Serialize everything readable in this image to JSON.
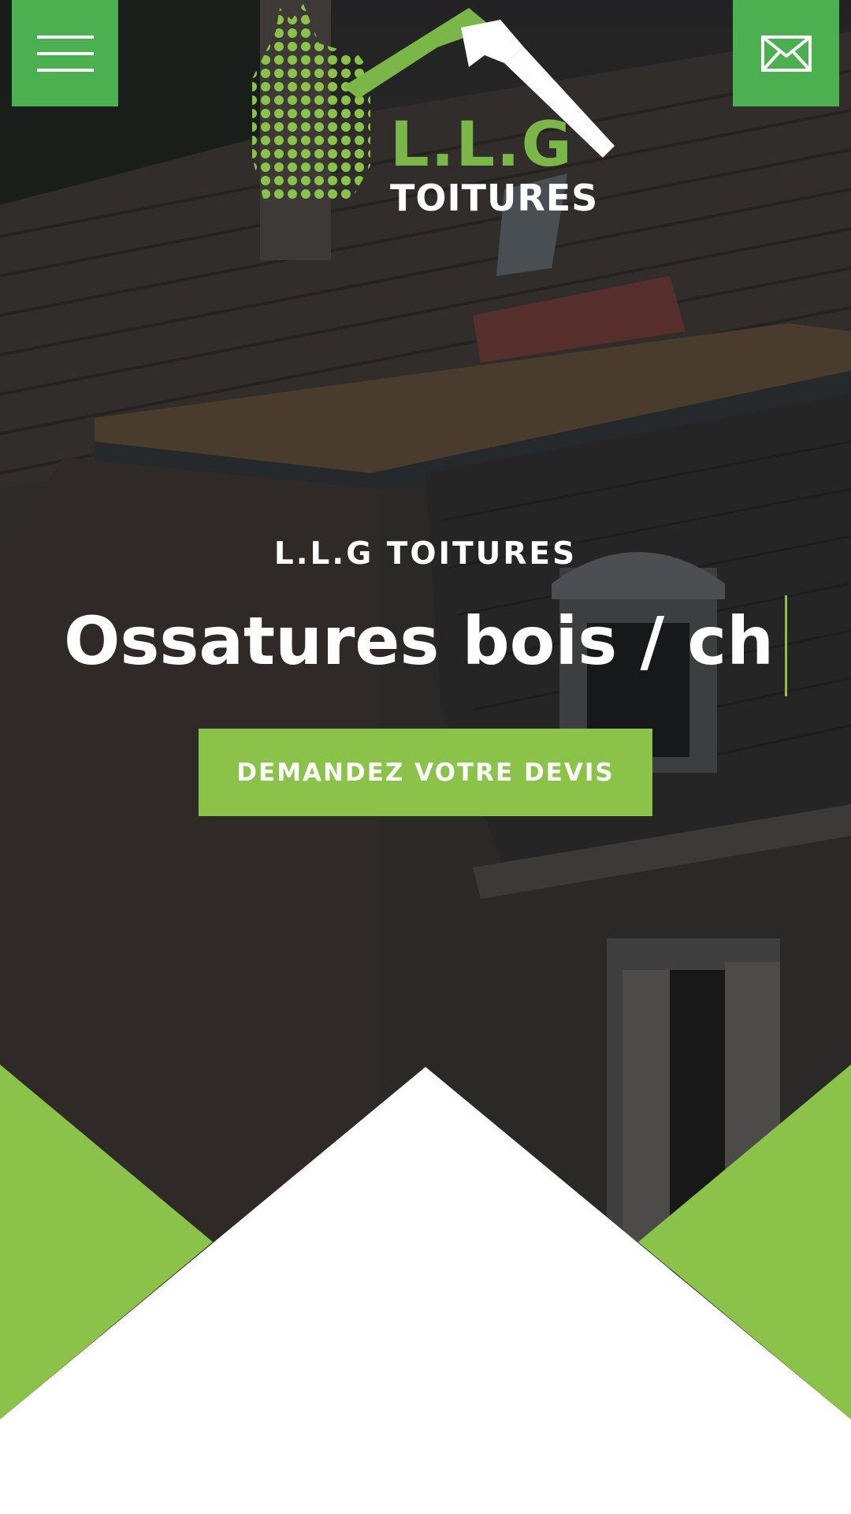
{
  "header": {
    "menu_icon": "hamburger-icon",
    "mail_icon": "envelope-icon",
    "logo": {
      "name": "L.L.G",
      "subtitle": "TOITURES"
    }
  },
  "hero": {
    "kicker": "L.L.G TOITURES",
    "headline": "Ossatures bois / ch",
    "cta_label": "DEMANDEZ VOTRE DEVIS"
  },
  "colors": {
    "button_green": "#4caf50",
    "accent_green": "#8bc34a",
    "text": "#ffffff"
  }
}
